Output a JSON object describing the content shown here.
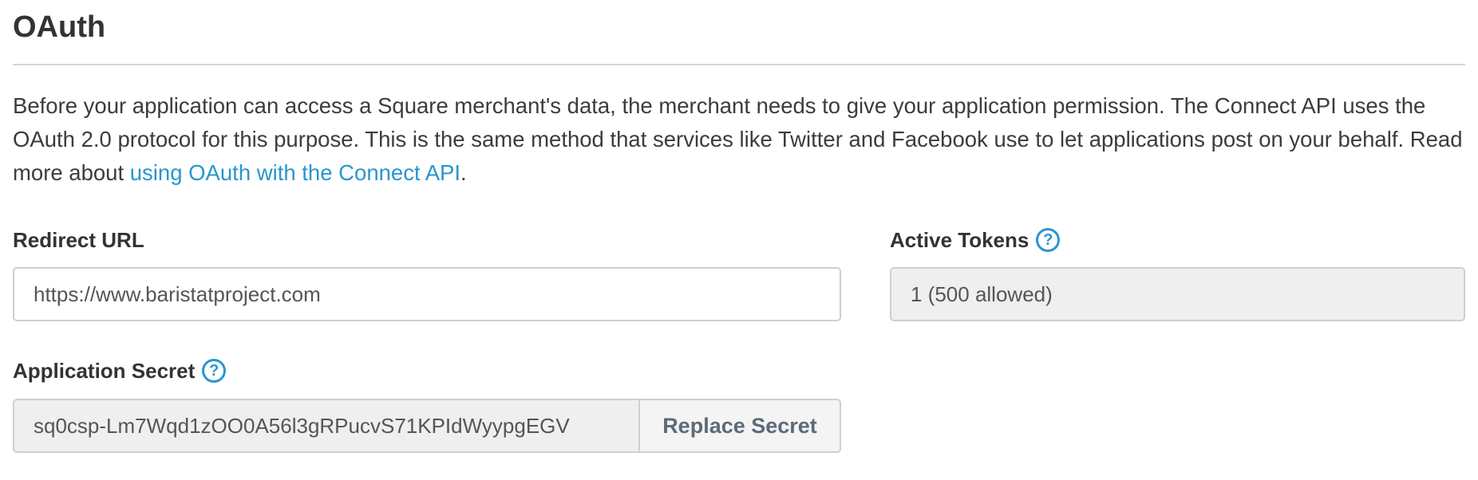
{
  "section": {
    "title": "OAuth"
  },
  "intro": {
    "text_before_link": "Before your application can access a Square merchant's data, the merchant needs to give your application permission. The Connect API uses the OAuth 2.0 protocol for this purpose. This is the same method that services like Twitter and Facebook use to let applications post on your behalf. Read more about ",
    "link_text": "using OAuth with the Connect API",
    "text_after_link": "."
  },
  "redirect_url": {
    "label": "Redirect URL",
    "value": "https://www.baristatproject.com"
  },
  "active_tokens": {
    "label": "Active Tokens",
    "help_glyph": "?",
    "value": "1 (500 allowed)"
  },
  "application_secret": {
    "label": "Application Secret",
    "help_glyph": "?",
    "value": "sq0csp-Lm7Wqd1zOO0A56l3gRPucvS71KPIdWyypgEGV",
    "replace_button_label": "Replace Secret"
  },
  "colors": {
    "link": "#2996cc",
    "help_icon": "#2996cc",
    "readonly_background": "#efefef",
    "button_text": "#5d6a78"
  },
  "icons": {
    "help": "question-circle-icon"
  }
}
